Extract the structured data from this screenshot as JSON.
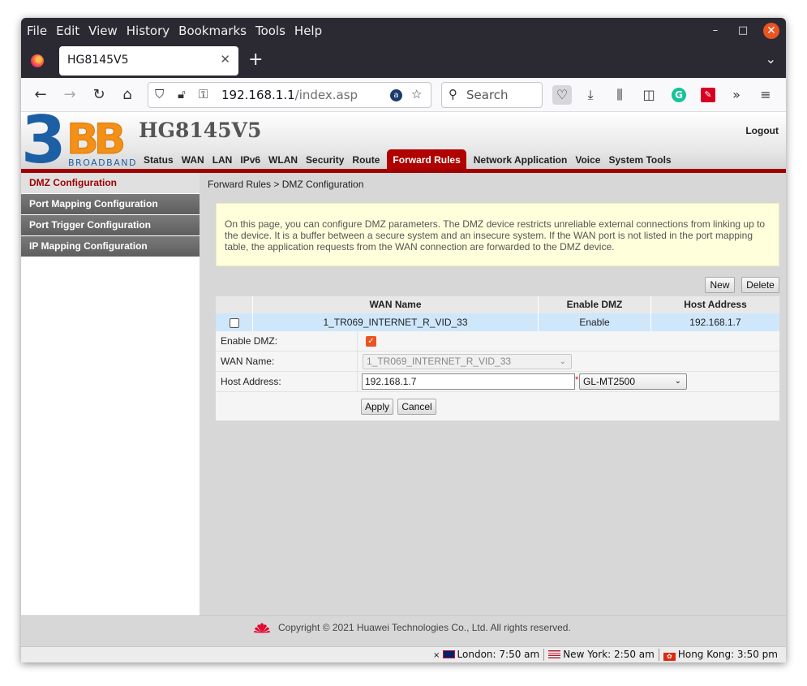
{
  "browser": {
    "menu": [
      "File",
      "Edit",
      "View",
      "History",
      "Bookmarks",
      "Tools",
      "Help"
    ],
    "tab_title": "HG8145V5",
    "url_host": "192.168.1.1",
    "url_path": "/index.asp",
    "search_placeholder": "Search"
  },
  "router": {
    "logo_text": "BB",
    "logo_sub": "BROADBAND",
    "device_title": "HG8145V5",
    "logout": "Logout",
    "nav": [
      "Status",
      "WAN",
      "LAN",
      "IPv6",
      "WLAN",
      "Security",
      "Route",
      "Forward Rules",
      "Network Application",
      "Voice",
      "System Tools"
    ],
    "active_nav": "Forward Rules",
    "sidebar": [
      "DMZ Configuration",
      "Port Mapping Configuration",
      "Port Trigger Configuration",
      "IP Mapping Configuration"
    ],
    "breadcrumb": "Forward Rules > DMZ Configuration",
    "notice": "On this page, you can configure DMZ parameters. The DMZ device restricts unreliable external connections from linking up to the device. It is a buffer between a secure system and an insecure system. If the WAN port is not listed in the port mapping table, the application requests from the WAN connection are forwarded to the DMZ device.",
    "buttons": {
      "new": "New",
      "delete": "Delete",
      "apply": "Apply",
      "cancel": "Cancel"
    },
    "table": {
      "headers": [
        "WAN Name",
        "Enable DMZ",
        "Host Address"
      ],
      "rows": [
        {
          "wan_name": "1_TR069_INTERNET_R_VID_33",
          "enable": "Enable",
          "host": "192.168.1.7"
        }
      ]
    },
    "form": {
      "enable_label": "Enable DMZ:",
      "enable_checked": true,
      "wan_label": "WAN Name:",
      "wan_value": "1_TR069_INTERNET_R_VID_33",
      "host_label": "Host Address:",
      "host_value": "192.168.1.7",
      "required_mark": "*",
      "device_select": "GL-MT2500"
    },
    "footer": "Copyright © 2021 Huawei Technologies Co., Ltd. All rights reserved."
  },
  "statusbar": {
    "clocks": [
      "London: 7:50 am",
      "New York: 2:50 am",
      "Hong Kong: 3:50 pm"
    ]
  },
  "colors": {
    "accent_red": "#a00000",
    "logo_blue": "#1d5fa5",
    "logo_orange": "#f39018"
  }
}
